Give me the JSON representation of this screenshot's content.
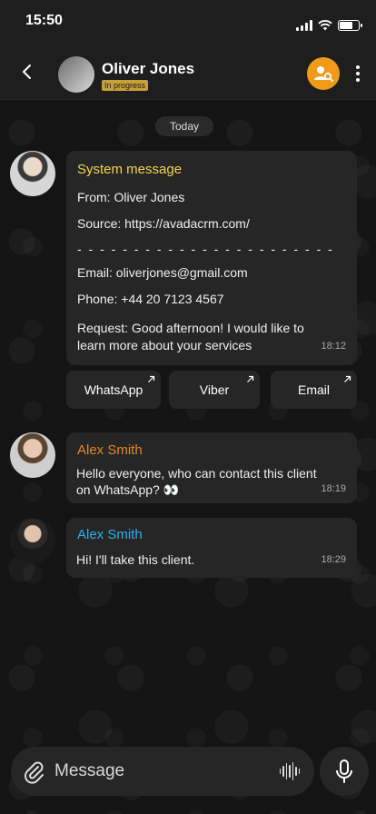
{
  "status_bar": {
    "time": "15:50"
  },
  "header": {
    "contact_name": "Oliver Jones",
    "status": "In progress",
    "accent_color": "#f09a1a",
    "status_badge_color": "#c8a03a"
  },
  "chat": {
    "date_label": "Today",
    "system_message": {
      "sender": "System message",
      "from": "From: Oliver Jones",
      "source": "Source: https://avadacrm.com/",
      "separator": "- - - - - - - - - - - - - - - - - - - - - - -",
      "email": "Email: oliverjones@gmail.com",
      "phone": "Phone: +44 20 7123 4567",
      "request": "Request: Good afternoon! I would like to learn more about your services",
      "time": "18:12"
    },
    "actions": [
      "WhatsApp",
      "Viber",
      "Email"
    ],
    "messages": [
      {
        "sender": "Alex Smith",
        "sender_color": "#e0892c",
        "text": "Hello everyone, who can contact this client on WhatsApp? 👀",
        "time": "18:19"
      },
      {
        "sender": "Alex Smith",
        "sender_color": "#2bb0ef",
        "text": "Hi! I'll take this client.",
        "time": "18:29"
      }
    ]
  },
  "composer": {
    "placeholder": "Message"
  },
  "icons": {
    "back": "chevron-left-icon",
    "assign": "user-search-icon",
    "more": "more-vertical-icon",
    "attach": "paperclip-icon",
    "voice": "waveform-icon",
    "mic": "microphone-icon",
    "external": "arrow-up-right-icon"
  }
}
